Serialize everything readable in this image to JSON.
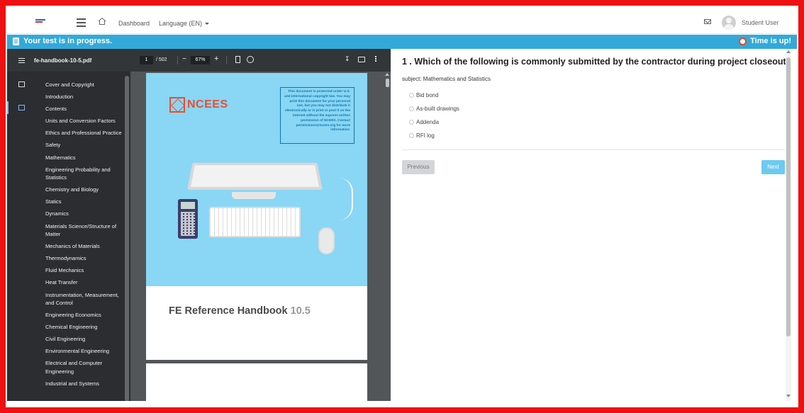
{
  "navbar": {
    "nav_dashboard": "Dashboard",
    "nav_language": "Language (EN)",
    "user_name": "Student User"
  },
  "status": {
    "progress_text": "Your test is in progress.",
    "time_text": "Time is up!",
    "bar_color": "#33a9d9"
  },
  "pdf": {
    "file_name": "fe-handbook-10-5.pdf",
    "page_current": "1",
    "page_total": "/ 502",
    "zoom": "67%",
    "outline": [
      "Cover and Copyright",
      "Introduction",
      "Contents",
      "Units and Conversion Factors",
      "Ethics and Professional Practice",
      "Safety",
      "Mathematics",
      "Engineering Probability and Statistics",
      "Chemistry and Biology",
      "Statics",
      "Dynamics",
      "Materials Science/Structure of Matter",
      "Mechanics of Materials",
      "Thermodynamics",
      "Fluid Mechanics",
      "Heat Transfer",
      "Instrumentation, Measurement, and Control",
      "Engineering Economics",
      "Chemical Engineering",
      "Civil Engineering",
      "Environmental Engineering",
      "Electrical and Computer Engineering",
      "Industrial and Systems"
    ],
    "cover": {
      "logo_text": "NCEES",
      "copyright_notice": "This document is protected under U.S. and international copyright law. You may print this document for your personal use, but you may not distribute it electronically or in print or post it on the internet without the express written permission of NCEES. Contact permissions@ncees.org for more information.",
      "title": "FE Reference Handbook",
      "version": "10.5",
      "brand_color": "#e84e2f",
      "cover_color": "#8ad6f5"
    }
  },
  "question": {
    "title": "1 . Which of the following is commonly submitted by the contractor during project closeout?",
    "subject": "subject: Mathematics and Statistics",
    "options": [
      "Bid bond",
      "As-built drawings",
      "Addenda",
      "RFI log"
    ],
    "prev_label": "Previous",
    "next_label": "Next"
  }
}
